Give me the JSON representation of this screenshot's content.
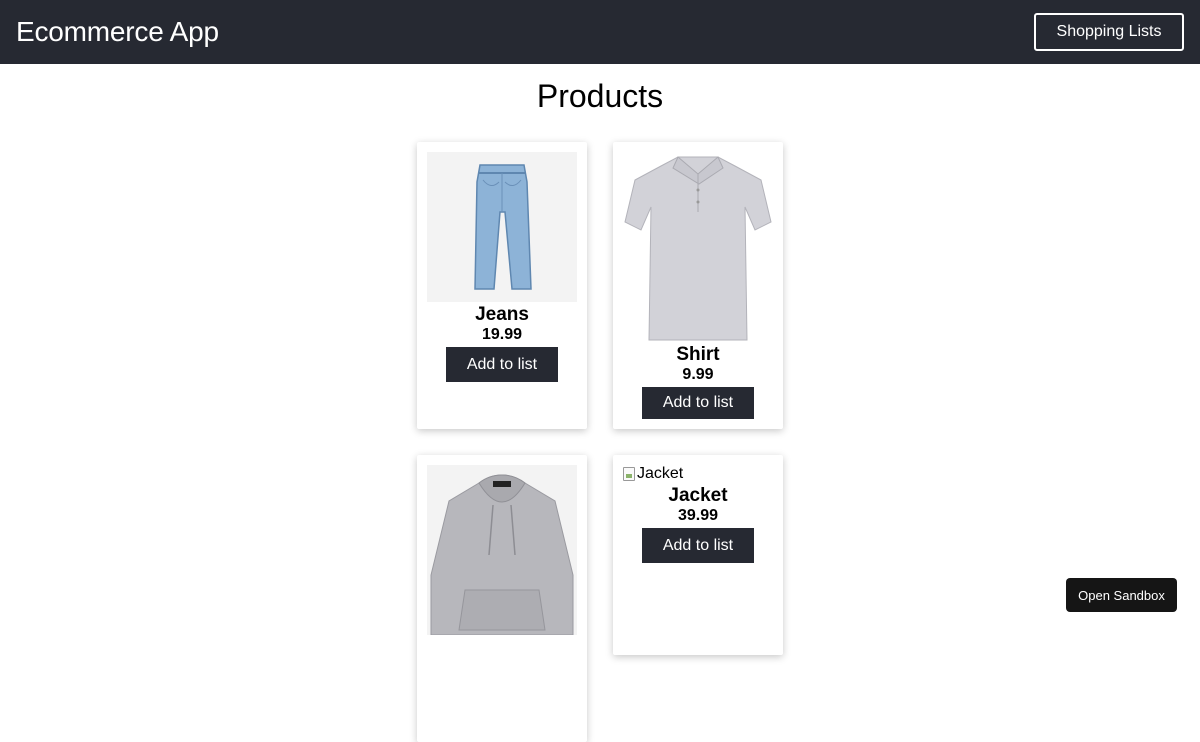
{
  "navbar": {
    "brand": "Ecommerce App",
    "shopping_lists_label": "Shopping Lists"
  },
  "page": {
    "title": "Products"
  },
  "products": [
    {
      "name": "Jeans",
      "price": "19.99",
      "button": "Add to list",
      "image_icon": "jeans-image"
    },
    {
      "name": "Shirt",
      "price": "9.99",
      "button": "Add to list",
      "image_icon": "shirt-image"
    },
    {
      "name": "",
      "price": "",
      "button": "",
      "image_icon": "hoodie-image"
    },
    {
      "name": "Jacket",
      "price": "39.99",
      "button": "Add to list",
      "image_alt": "Jacket",
      "image_icon": "broken-image-icon"
    }
  ],
  "sandbox": {
    "label": "Open Sandbox"
  },
  "colors": {
    "navbar_bg": "#262932",
    "button_bg": "#262932",
    "sandbox_bg": "#151515"
  }
}
